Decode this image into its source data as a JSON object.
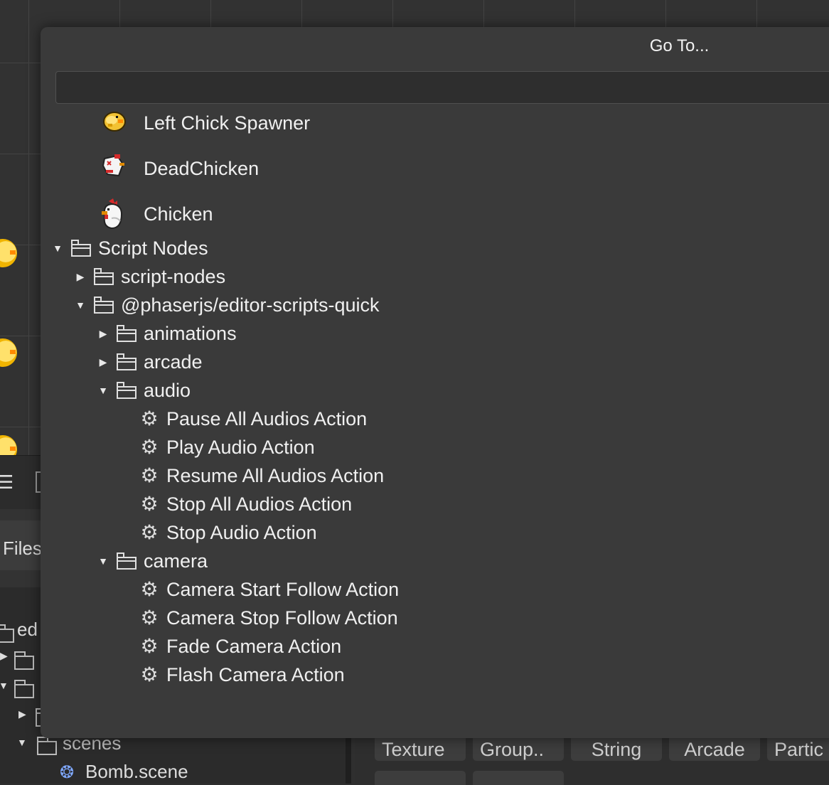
{
  "dialog": {
    "title": "Go To...",
    "search": {
      "value": "",
      "placeholder": ""
    }
  },
  "results": {
    "sprites": [
      {
        "label": "Left Chick Spawner",
        "icon": "chick-sprite-icon"
      },
      {
        "label": "DeadChicken",
        "icon": "dead-chicken-sprite-icon"
      },
      {
        "label": "Chicken",
        "icon": "chicken-sprite-icon"
      }
    ],
    "tree": [
      {
        "label": "Script Nodes",
        "type": "folder",
        "level": 0,
        "expanded": true
      },
      {
        "label": "script-nodes",
        "type": "folder",
        "level": 1,
        "expanded": false
      },
      {
        "label": "@phaserjs/editor-scripts-quick",
        "type": "folder",
        "level": 1,
        "expanded": true
      },
      {
        "label": "animations",
        "type": "folder",
        "level": 2,
        "expanded": false
      },
      {
        "label": "arcade",
        "type": "folder",
        "level": 2,
        "expanded": false
      },
      {
        "label": "audio",
        "type": "folder",
        "level": 2,
        "expanded": true
      },
      {
        "label": "Pause All Audios Action",
        "type": "script",
        "level": 3
      },
      {
        "label": "Play Audio Action",
        "type": "script",
        "level": 3
      },
      {
        "label": "Resume All Audios Action",
        "type": "script",
        "level": 3
      },
      {
        "label": "Stop All Audios Action",
        "type": "script",
        "level": 3
      },
      {
        "label": "Stop Audio Action",
        "type": "script",
        "level": 3
      },
      {
        "label": "camera",
        "type": "folder",
        "level": 2,
        "expanded": true
      },
      {
        "label": "Camera Start Follow Action",
        "type": "script",
        "level": 3
      },
      {
        "label": "Camera Stop Follow Action",
        "type": "script",
        "level": 3
      },
      {
        "label": "Fade Camera Action",
        "type": "script",
        "level": 3
      },
      {
        "label": "Flash Camera Action",
        "type": "script",
        "level": 3
      }
    ]
  },
  "background": {
    "files_tab": "Files",
    "files_rows": {
      "editor_folder": "ed",
      "scenes_folder": "scenes",
      "bomb_scene": "Bomb.scene"
    },
    "palette_tabs": [
      "Texture",
      "Group..",
      "String",
      "Arcade",
      "Partic"
    ]
  },
  "colors": {
    "dialog_bg": "#3a3a3a",
    "input_bg": "#2e2e2e",
    "text": "#f0f0f0",
    "app_bg": "#2f2f2f"
  }
}
